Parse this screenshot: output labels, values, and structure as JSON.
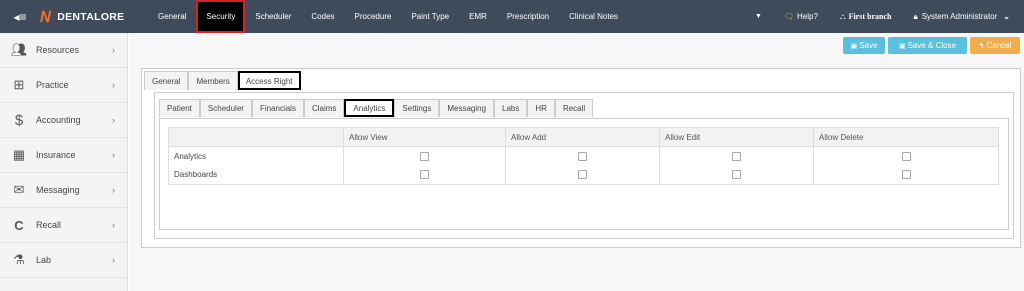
{
  "brand": {
    "name": "DENTALORE"
  },
  "nav": [
    {
      "label": "General"
    },
    {
      "label": "Security"
    },
    {
      "label": "Scheduler"
    },
    {
      "label": "Codes"
    },
    {
      "label": "Procedure"
    },
    {
      "label": "Paint Type"
    },
    {
      "label": "EMR"
    },
    {
      "label": "Prescription"
    },
    {
      "label": "Clinical Notes"
    }
  ],
  "topright": {
    "help": "Help?",
    "branch": "First branch",
    "user": "System Administrator"
  },
  "sidebar": [
    {
      "label": "Resources",
      "icon": "users-icon"
    },
    {
      "label": "Practice",
      "icon": "medkit-icon"
    },
    {
      "label": "Accounting",
      "icon": "dollar-icon"
    },
    {
      "label": "Insurance",
      "icon": "building-icon"
    },
    {
      "label": "Messaging",
      "icon": "envelope-icon"
    },
    {
      "label": "Recall",
      "icon": "refresh-icon"
    },
    {
      "label": "Lab",
      "icon": "flask-icon"
    }
  ],
  "actions": {
    "save": "Save",
    "save_close": "Save & Close",
    "cancel": "Cancel"
  },
  "tabs_outer": [
    {
      "label": "General"
    },
    {
      "label": "Members"
    },
    {
      "label": "Access Right"
    }
  ],
  "tabs_inner": [
    {
      "label": "Patient"
    },
    {
      "label": "Scheduler"
    },
    {
      "label": "Financials"
    },
    {
      "label": "Claims"
    },
    {
      "label": "Analytics"
    },
    {
      "label": "Settings"
    },
    {
      "label": "Messaging"
    },
    {
      "label": "Labs"
    },
    {
      "label": "HR"
    },
    {
      "label": "Recall"
    }
  ],
  "table": {
    "headers": [
      "",
      "Allow View",
      "Allow Add",
      "Allow Edit",
      "Allow Delete"
    ],
    "rows": [
      {
        "name": "Analytics"
      },
      {
        "name": "Dashboards"
      }
    ]
  },
  "colors": {
    "topbar": "#3f4b5b",
    "accent": "#f26b2d",
    "save": "#5bc0de",
    "cancel": "#f0ad4e",
    "active_nav_border": "#d81f26"
  }
}
